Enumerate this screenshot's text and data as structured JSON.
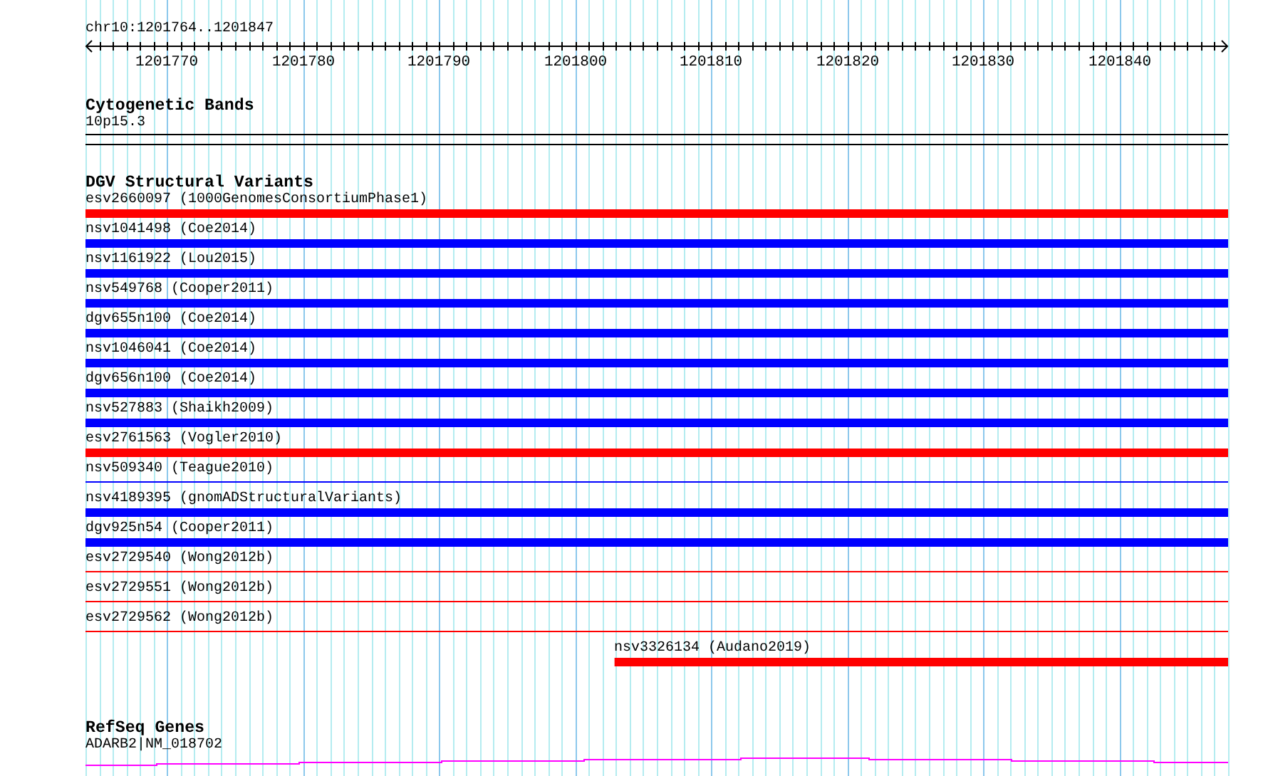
{
  "ruler": {
    "position": "chr10:1201764..1201847",
    "ticks": [
      "1201770",
      "1201780",
      "1201790",
      "1201800",
      "1201810",
      "1201820",
      "1201830",
      "1201840"
    ]
  },
  "cytogenetic_bands": {
    "title": "Cytogenetic Bands",
    "band": "10p15.3"
  },
  "dgv": {
    "title": "DGV Structural Variants",
    "variants": [
      {
        "label": "esv2660097 (1000GenomesConsortiumPhase1)",
        "color": "#ff0000",
        "kind": "thick"
      },
      {
        "label": "nsv1041498 (Coe2014)",
        "color": "#0000ff",
        "kind": "thick"
      },
      {
        "label": "nsv1161922 (Lou2015)",
        "color": "#0000ff",
        "kind": "thick"
      },
      {
        "label": "nsv549768 (Cooper2011)",
        "color": "#0000ff",
        "kind": "thick"
      },
      {
        "label": "dgv655n100 (Coe2014)",
        "color": "#0000ff",
        "kind": "thick"
      },
      {
        "label": "nsv1046041 (Coe2014)",
        "color": "#0000ff",
        "kind": "thick"
      },
      {
        "label": "dgv656n100 (Coe2014)",
        "color": "#0000ff",
        "kind": "thick"
      },
      {
        "label": "nsv527883 (Shaikh2009)",
        "color": "#0000ff",
        "kind": "thick"
      },
      {
        "label": "esv2761563 (Vogler2010)",
        "color": "#ff0000",
        "kind": "thick"
      },
      {
        "label": "nsv509340 (Teague2010)",
        "color": "#0000ff",
        "kind": "thin"
      },
      {
        "label": "nsv4189395 (gnomADStructuralVariants)",
        "color": "#0000ff",
        "kind": "thick"
      },
      {
        "label": "dgv925n54 (Cooper2011)",
        "color": "#0000ff",
        "kind": "thick"
      },
      {
        "label": "esv2729540 (Wong2012b)",
        "color": "#ff0000",
        "kind": "thin"
      },
      {
        "label": "esv2729551 (Wong2012b)",
        "color": "#ff0000",
        "kind": "thin"
      },
      {
        "label": "esv2729562 (Wong2012b)",
        "color": "#ff0000",
        "kind": "thin"
      },
      {
        "label": "nsv3326134 (Audano2019)",
        "color": "#ff0000",
        "kind": "thick",
        "level": 0.537
      }
    ]
  },
  "refseq": {
    "title": "RefSeq Genes",
    "gene": "ADARB2|NM_018702"
  }
}
